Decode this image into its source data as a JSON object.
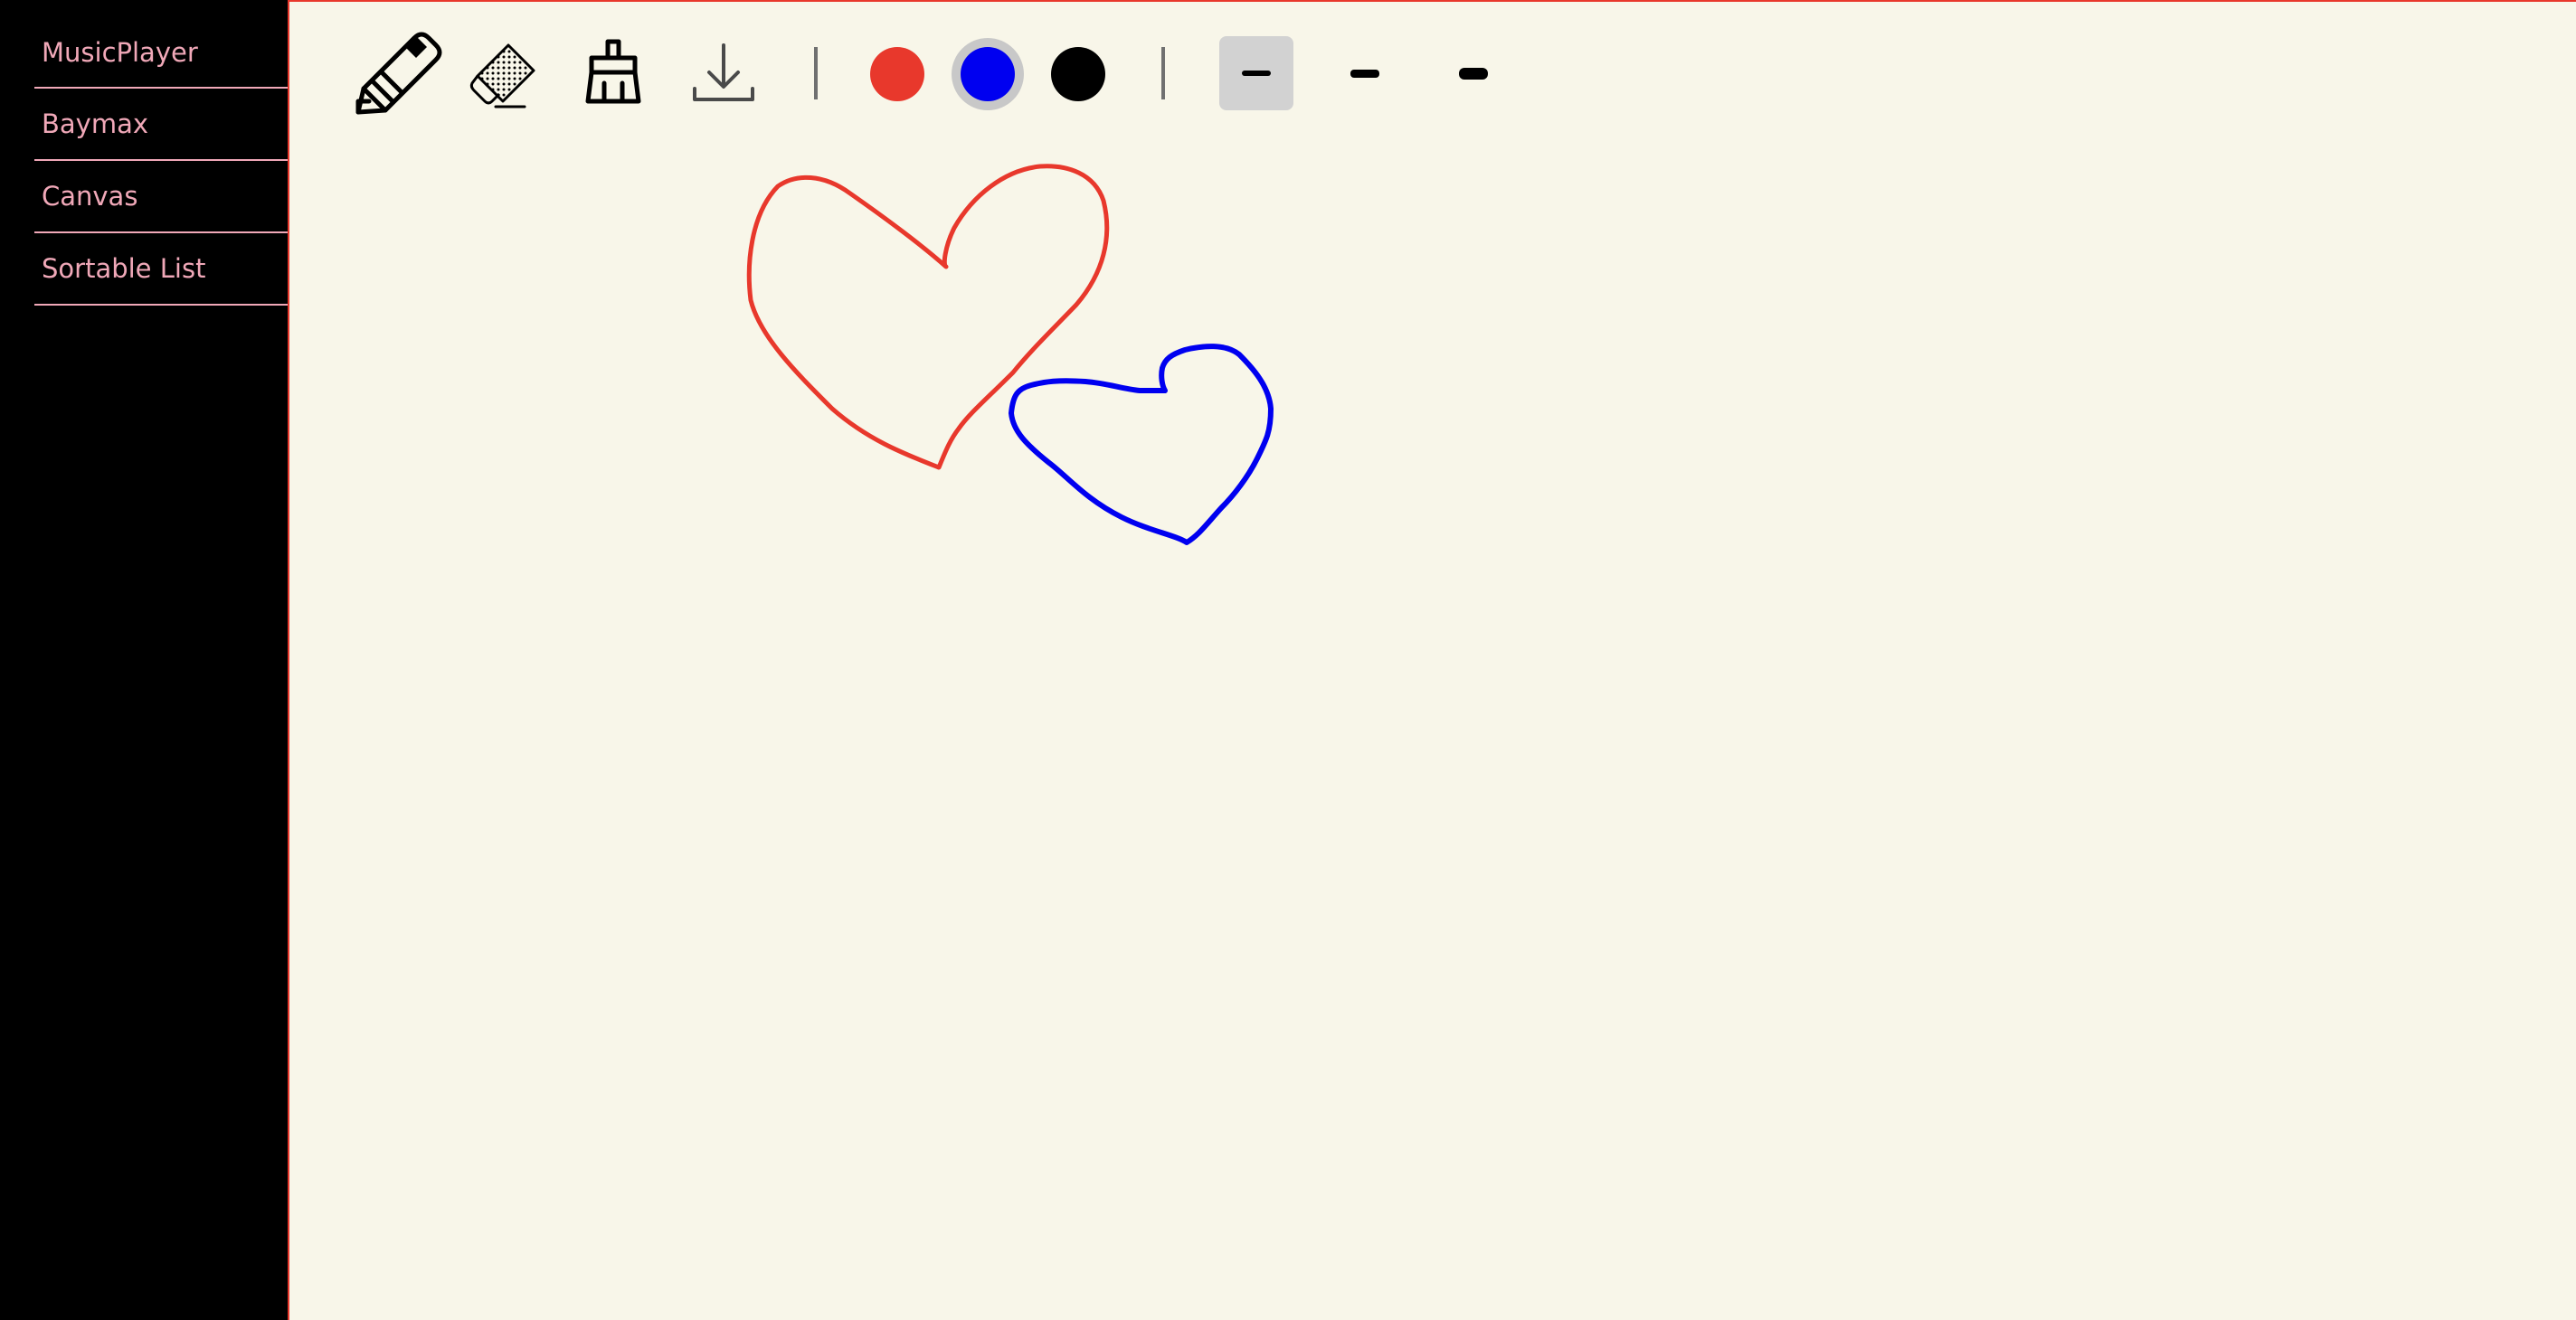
{
  "sidebar": {
    "items": [
      {
        "label": "MusicPlayer"
      },
      {
        "label": "Baymax"
      },
      {
        "label": "Canvas"
      },
      {
        "label": "Sortable List"
      }
    ]
  },
  "toolbar": {
    "tools": [
      {
        "icon": "pencil-icon",
        "selected": true
      },
      {
        "icon": "eraser-icon",
        "selected": false
      },
      {
        "icon": "clear-brush-icon",
        "selected": false
      },
      {
        "icon": "download-icon",
        "selected": false
      }
    ],
    "colors": [
      {
        "value": "#e8382c",
        "selected": false
      },
      {
        "value": "#0000f0",
        "selected": true
      },
      {
        "value": "#000000",
        "selected": false
      }
    ],
    "sizes": [
      {
        "name": "thin",
        "selected": true
      },
      {
        "name": "medium",
        "selected": false
      },
      {
        "name": "thick",
        "selected": false
      }
    ]
  },
  "theme": {
    "sidebar_bg": "#000000",
    "nav_text": "#f0a8b8",
    "canvas_bg": "#f8f6e9",
    "accent": "#e8382c"
  },
  "drawing": {
    "strokes": [
      {
        "color": "#e8382c",
        "shape": "heart"
      },
      {
        "color": "#0000f0",
        "shape": "heart"
      }
    ]
  }
}
